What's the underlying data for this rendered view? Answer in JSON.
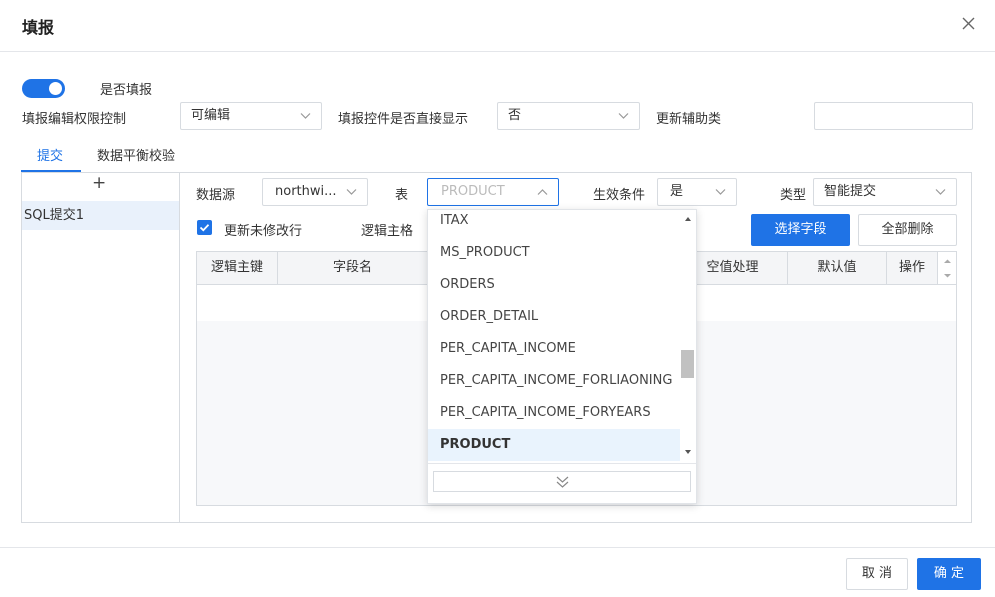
{
  "dialog": {
    "title": "填报"
  },
  "settings": {
    "enable_label": "是否填报",
    "permission_label": "填报编辑权限控制",
    "permission_value": "可编辑",
    "display_label": "填报控件是否直接显示",
    "display_value": "否",
    "aux_label": "更新辅助类",
    "aux_value": ""
  },
  "tabs": [
    {
      "label": "提交"
    },
    {
      "label": "数据平衡校验"
    }
  ],
  "left_panel": {
    "add_symbol": "+",
    "items": [
      {
        "label": "SQL提交1"
      }
    ]
  },
  "form": {
    "datasource_label": "数据源",
    "datasource_value": "northwi...",
    "table_label": "表",
    "table_placeholder": "PRODUCT",
    "condition_label": "生效条件",
    "condition_value": "是",
    "type_label": "类型",
    "type_value": "智能提交",
    "update_unmodified_label": "更新未修改行",
    "logic_key_label": "逻辑主格",
    "choose_fields_label": "选择字段",
    "delete_all_label": "全部删除"
  },
  "table": {
    "columns": [
      "逻辑主键",
      "字段名",
      "",
      "空值处理",
      "默认值",
      "操作"
    ],
    "rows": []
  },
  "dropdown": {
    "options": [
      "ITAX",
      "MS_PRODUCT",
      "ORDERS",
      "ORDER_DETAIL",
      "PER_CAPITA_INCOME",
      "PER_CAPITA_INCOME_FORLIAONING",
      "PER_CAPITA_INCOME_FORYEARS",
      "PRODUCT"
    ],
    "selected": "PRODUCT"
  },
  "footer": {
    "cancel_label": "取 消",
    "ok_label": "确 定"
  },
  "colors": {
    "primary": "#1f73e6",
    "selected_row": "#e9f3fd",
    "border": "#d7dbe0"
  },
  "icons": {
    "close": "close-icon",
    "chevron": "chevron-down-icon",
    "chevron_up": "chevron-up-icon",
    "check": "check-icon",
    "more": "double-chevron-down-icon"
  }
}
